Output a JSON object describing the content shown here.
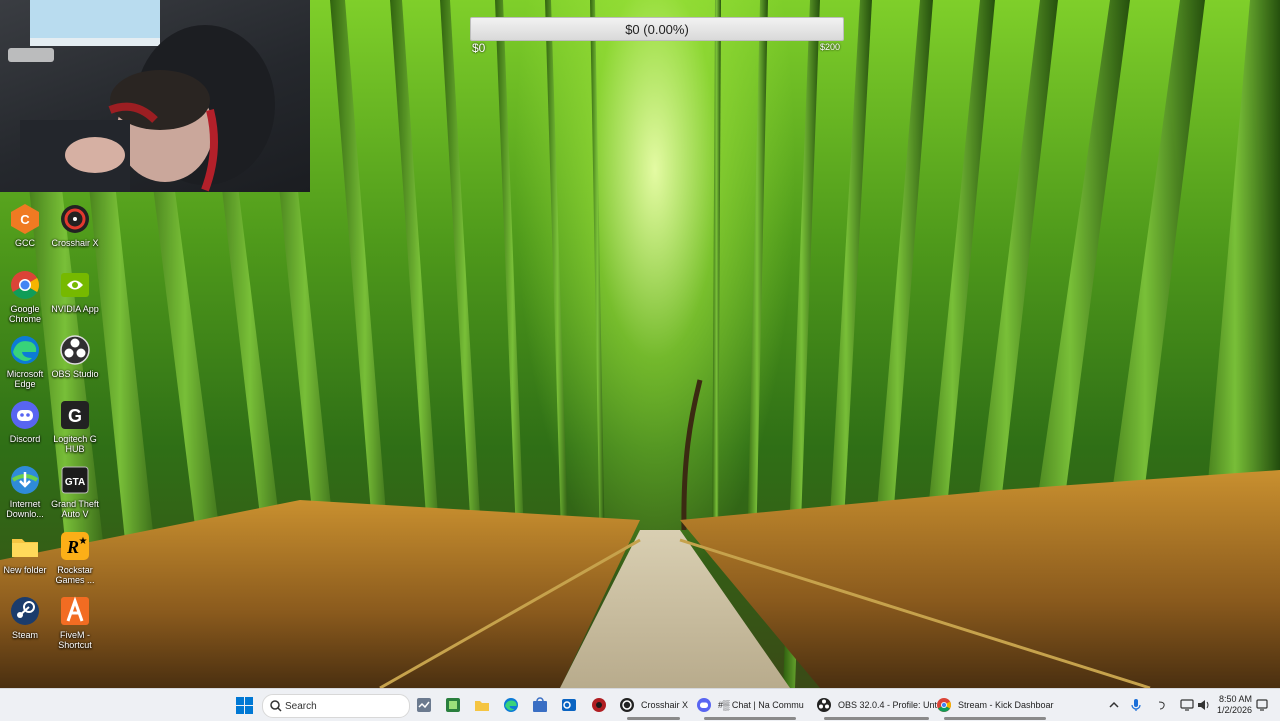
{
  "overlay": {
    "goal_text": "$0 (0.00%)",
    "goal_min": "$0",
    "goal_max": "$200",
    "progress_fraction": 0.0
  },
  "desktop_icons": [
    {
      "label": "GCC",
      "icon": "gcc-icon"
    },
    {
      "label": "Crosshair X",
      "icon": "crosshair-x-icon"
    },
    {
      "label": "Google Chrome",
      "icon": "chrome-icon"
    },
    {
      "label": "NVIDIA App",
      "icon": "nvidia-icon"
    },
    {
      "label": "Microsoft Edge",
      "icon": "edge-icon"
    },
    {
      "label": "OBS Studio",
      "icon": "obs-icon"
    },
    {
      "label": "Discord",
      "icon": "discord-icon"
    },
    {
      "label": "Logitech G HUB",
      "icon": "logitech-g-icon"
    },
    {
      "label": "Internet Downlo...",
      "icon": "idm-icon"
    },
    {
      "label": "Grand Theft Auto V",
      "icon": "gta-icon"
    },
    {
      "label": "New folder",
      "icon": "folder-icon"
    },
    {
      "label": "Rockstar Games ...",
      "icon": "rockstar-icon"
    },
    {
      "label": "Steam",
      "icon": "steam-icon"
    },
    {
      "label": "FiveM - Shortcut",
      "icon": "fivem-icon"
    }
  ],
  "taskbar": {
    "search_placeholder": "Search",
    "apps": [
      {
        "label": "",
        "icon": "task-manager-icon"
      },
      {
        "label": "",
        "icon": "hwinfo-icon"
      },
      {
        "label": "",
        "icon": "file-explorer-icon"
      },
      {
        "label": "",
        "icon": "edge-icon"
      },
      {
        "label": "",
        "icon": "store-icon"
      },
      {
        "label": "",
        "icon": "outlook-icon"
      },
      {
        "label": "",
        "icon": "record-icon"
      },
      {
        "label": "Crosshair X",
        "icon": "crosshair-x-icon"
      },
      {
        "label": "#▒ Chat | Na Commu",
        "icon": "discord-icon"
      },
      {
        "label": "OBS 32.0.4 - Profile: Unt",
        "icon": "obs-icon"
      },
      {
        "label": "Stream - Kick Dashboar",
        "icon": "chrome-icon"
      }
    ],
    "tray": {
      "clock_time": "8:50 AM",
      "clock_date": "1/2/2026"
    }
  },
  "colors": {
    "taskbar_bg": "#eef0f4",
    "windows_blue": "#0078d4",
    "goal_fill": "#7fd34e"
  }
}
